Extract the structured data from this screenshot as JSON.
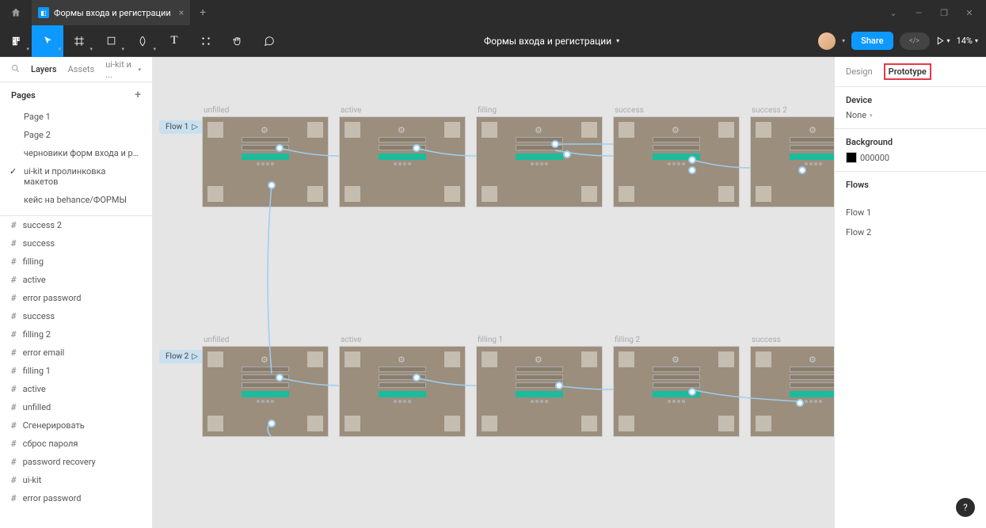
{
  "tab": {
    "title": "Формы входа и регистрации"
  },
  "toolbar": {
    "title": "Формы входа и регистрации",
    "share": "Share",
    "zoom": "14%"
  },
  "leftPanel": {
    "tabs": {
      "layers": "Layers",
      "assets": "Assets",
      "pageDropdown": "ui-kit и ..."
    },
    "pagesHeader": "Pages",
    "pages": [
      {
        "name": "Page 1"
      },
      {
        "name": "Page 2"
      },
      {
        "name": "черновики форм входа и реги..."
      },
      {
        "name": "ui-kit и пролинковка макетов",
        "checked": true
      },
      {
        "name": "кейс на behance/ФОРМЫ"
      }
    ],
    "layers": [
      "success 2",
      "success",
      "filling",
      "active",
      "error password",
      "success",
      "filling 2",
      "error email",
      "filling 1",
      "active",
      "unfilled",
      "Сгенерировать",
      "сброс пароля",
      "password recovery",
      "ui-kit",
      "error password"
    ]
  },
  "canvas": {
    "flow1": {
      "badge": "Flow 1",
      "frames": [
        "unfilled",
        "active",
        "filling",
        "success",
        "success 2"
      ]
    },
    "flow2": {
      "badge": "Flow 2",
      "frames": [
        "unfilled",
        "active",
        "filling 1",
        "filling 2",
        "success"
      ]
    }
  },
  "rightPanel": {
    "tabs": {
      "design": "Design",
      "prototype": "Prototype"
    },
    "device": {
      "label": "Device",
      "value": "None"
    },
    "background": {
      "label": "Background",
      "value": "000000"
    },
    "flows": {
      "label": "Flows",
      "items": [
        "Flow 1",
        "Flow 2"
      ]
    }
  }
}
